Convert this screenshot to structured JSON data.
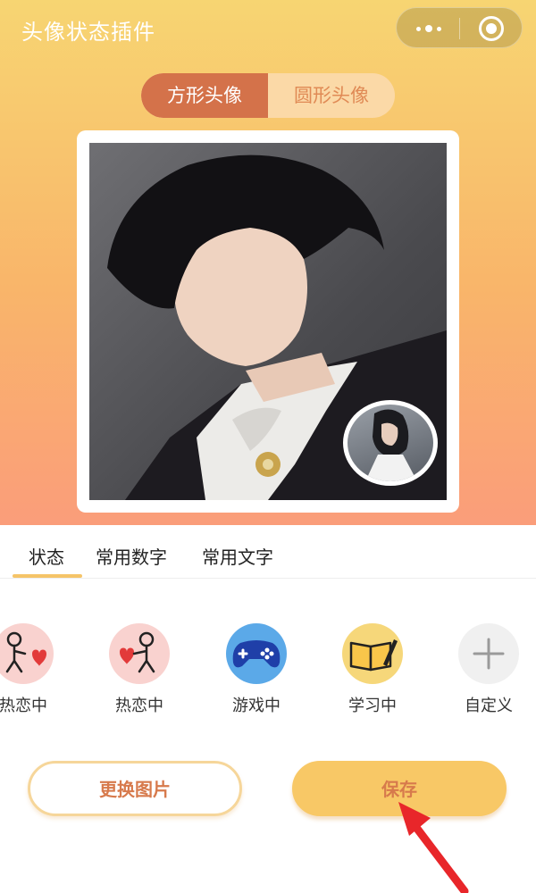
{
  "app": {
    "title": "头像状态插件"
  },
  "shape_toggle": {
    "options": [
      "方形头像",
      "圆形头像"
    ],
    "active_index": 0
  },
  "tabs": {
    "items": [
      "状态",
      "常用数字",
      "常用文字"
    ],
    "active_index": 0
  },
  "status_icons": [
    {
      "label": "热恋中",
      "icon": "stick-figure-heart-icon"
    },
    {
      "label": "热恋中",
      "icon": "stick-figure-heart-icon"
    },
    {
      "label": "游戏中",
      "icon": "gamepad-icon"
    },
    {
      "label": "学习中",
      "icon": "book-pen-icon"
    },
    {
      "label": "自定义",
      "icon": "plus-icon"
    }
  ],
  "buttons": {
    "change_image": "更换图片",
    "save": "保存"
  },
  "colors": {
    "accent_dark": "#d4724a",
    "accent_light": "#fbd9a7",
    "save_button": "#f8c866",
    "tab_underline": "#f5c468",
    "arrow": "#e8262a"
  }
}
